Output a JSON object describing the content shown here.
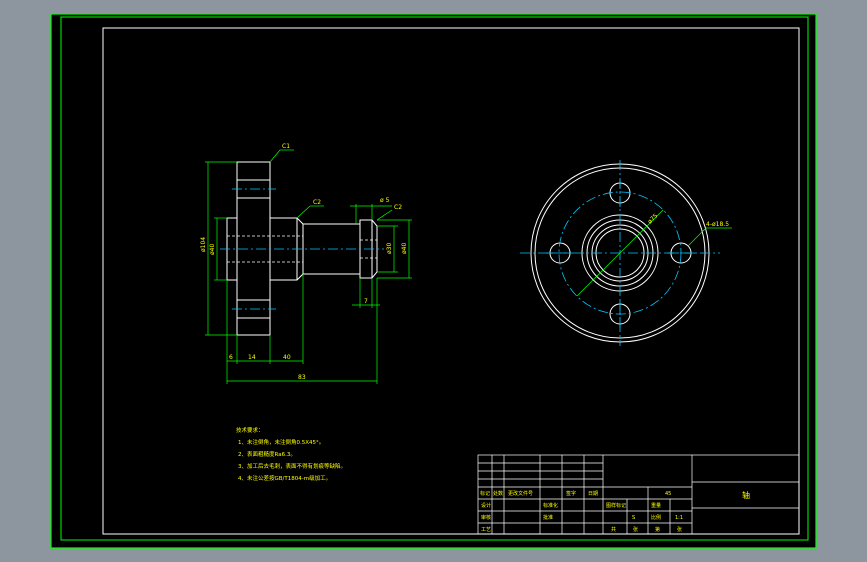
{
  "colors": {
    "background": "#8d969e",
    "sheet": "#000000",
    "border": "#00ff00",
    "outline": "#ffffff",
    "dimension": "#00ff00",
    "center": "#00c8ff",
    "label": "#ffff00"
  },
  "drawing": {
    "title": "轴",
    "front_view": {
      "dims": {
        "d_flange": "ø104",
        "d_hub": "ø40",
        "d_shaft": "ø30",
        "d_end": "ø40",
        "len_a": "6",
        "len_b": "14",
        "len_c": "40",
        "len_total": "83",
        "len_groove": "7",
        "d_groove": "ø 5",
        "chamfer_1": "C1",
        "chamfer_2": "C2",
        "chamfer_3": "C2"
      }
    },
    "side_view": {
      "dims": {
        "pcd": "ø75",
        "holes": "4-ø18.5"
      }
    },
    "notes": {
      "heading": "技术要求：",
      "items": [
        "1、未注倒角，未注倒角0.5X45°。",
        "2、表面粗糙度Ra6.3。",
        "3、加工后去毛刺，表面不得有划痕等缺陷。",
        "4、未注公差按GB/T1804-m级加工。"
      ]
    },
    "title_block": {
      "header_labels": [
        "标记",
        "处数",
        "更改文件号",
        "签字",
        "日期"
      ],
      "role_labels": [
        "设计",
        "审核",
        "工艺"
      ],
      "std_labels": [
        "标准化",
        "批准"
      ],
      "grid_labels": [
        "图样标记",
        "重量",
        "比例"
      ],
      "material": "45",
      "scale": "1:1",
      "count_labels": [
        "共",
        "张",
        "第",
        "张"
      ],
      "stage": "S"
    }
  }
}
